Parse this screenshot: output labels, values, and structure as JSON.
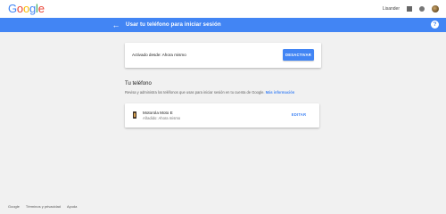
{
  "topbar": {
    "logo": [
      "G",
      "o",
      "o",
      "g",
      "l",
      "e"
    ],
    "logo_colors": [
      "#4285f4",
      "#ea4335",
      "#fbbc05",
      "#4285f4",
      "#34a853",
      "#ea4335"
    ],
    "username": "Lisander"
  },
  "header": {
    "title": "Usar tu teléfono para iniciar sesión",
    "back_icon": "arrow-left-icon",
    "help_icon": "help-icon",
    "help_glyph": "?",
    "bg_color": "#4285f4"
  },
  "status_card": {
    "label": "Activado desde: Ahora mismo",
    "button_label": "DESACTIVAR"
  },
  "phone_section": {
    "title": "Tu teléfono",
    "description": "Revisa y administra los teléfonos que usas para iniciar sesión en tu cuenta de Google.",
    "more_link": "Más información"
  },
  "device_card": {
    "name": "Motorola Moto E",
    "added": "Añadido: Ahora mismo",
    "edit_label": "EDITAR"
  },
  "footer": {
    "links": [
      "Google",
      "Términos y privacidad",
      "Ayuda"
    ]
  }
}
